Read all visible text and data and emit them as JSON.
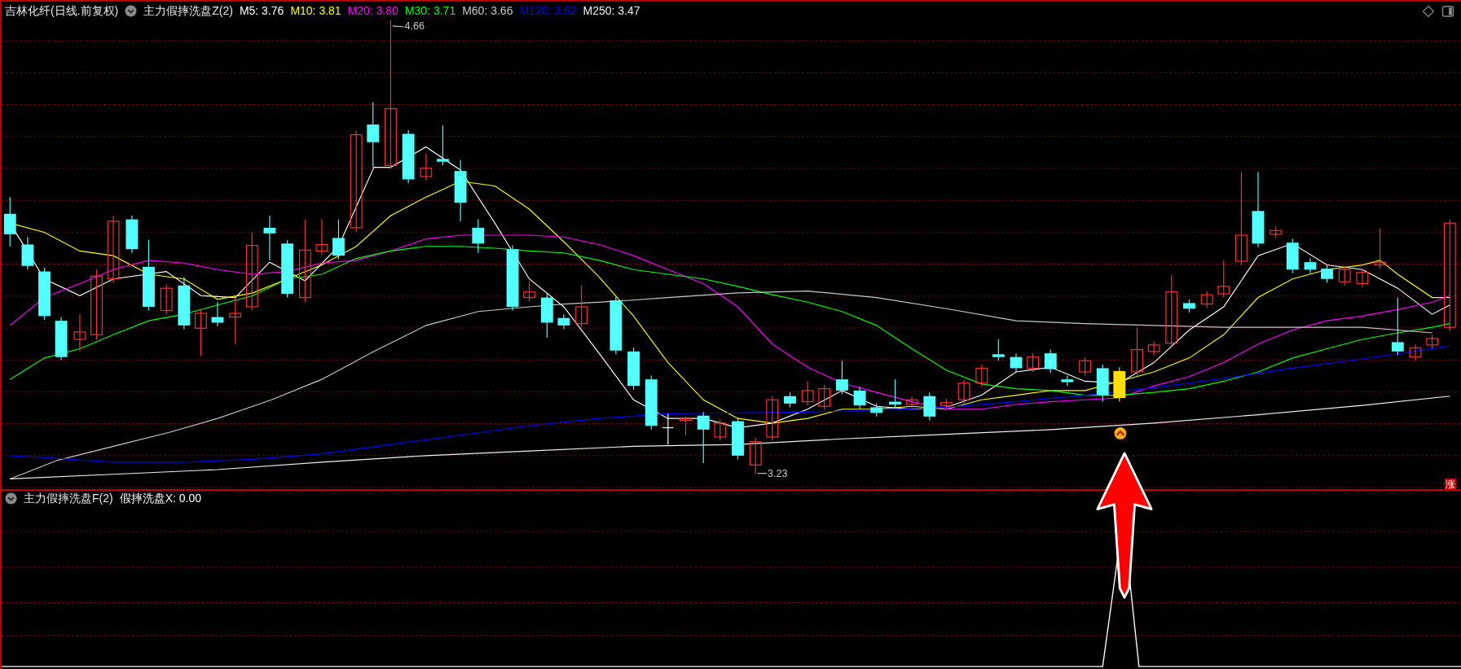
{
  "main_panel": {
    "stock_title": "吉林化纤(日线.前复权)",
    "indicator": "主力假摔洗盘Z(2)",
    "ma_readings": [
      {
        "label": "M5:",
        "value": "3.76",
        "color": "#ffffff"
      },
      {
        "label": "M10:",
        "value": "3.81",
        "color": "#ffff00"
      },
      {
        "label": "M20:",
        "value": "3.80",
        "color": "#ff00ff"
      },
      {
        "label": "M30:",
        "value": "3.71",
        "color": "#00ff00"
      },
      {
        "label": "M60:",
        "value": "3.66",
        "color": "#c8c8c8"
      },
      {
        "label": "M120:",
        "value": "3.62",
        "color": "#0000ff"
      },
      {
        "label": "M250:",
        "value": "3.47",
        "color": "#f0f0f0"
      }
    ],
    "high_label": "4.66",
    "low_label": "3.23",
    "badge": "涨"
  },
  "sub_panel": {
    "indicator": "主力假摔洗盘F(2)",
    "reading_label": "假摔洗盘X:",
    "reading_value": "0.00"
  }
}
